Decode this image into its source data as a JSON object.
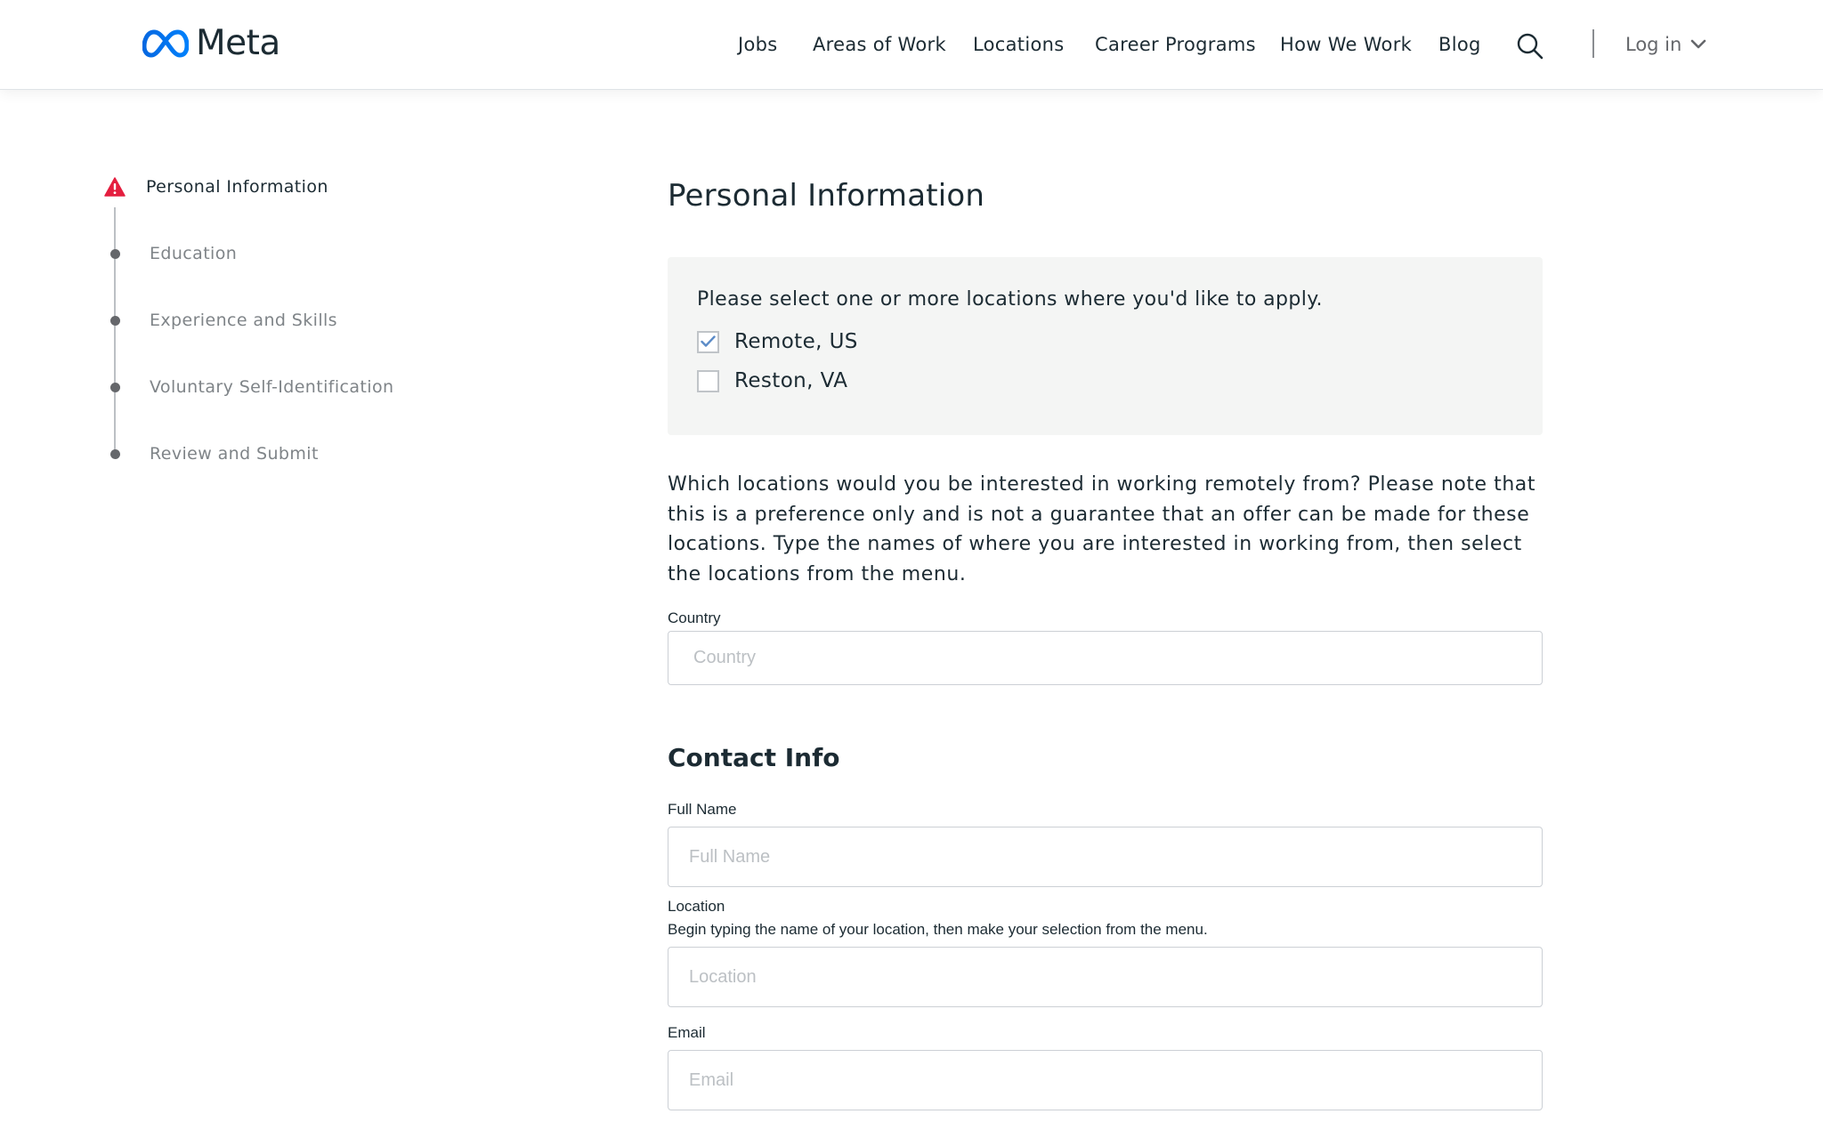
{
  "header": {
    "brand": "Meta",
    "nav": [
      "Jobs",
      "Areas of Work",
      "Locations",
      "Career Programs",
      "How We Work",
      "Blog"
    ],
    "login_label": "Log in"
  },
  "stepper": {
    "steps": [
      {
        "label": "Personal Information",
        "state": "error"
      },
      {
        "label": "Education",
        "state": "pending"
      },
      {
        "label": "Experience and Skills",
        "state": "pending"
      },
      {
        "label": "Voluntary Self-Identification",
        "state": "pending"
      },
      {
        "label": "Review and Submit",
        "state": "pending"
      }
    ]
  },
  "main": {
    "title": "Personal Information",
    "locations": {
      "prompt": "Please select one or more locations where you'd like to apply.",
      "options": [
        {
          "label": "Remote, US",
          "checked": true
        },
        {
          "label": "Reston, VA",
          "checked": false
        }
      ]
    },
    "remote_question": "Which locations would you be interested in working remotely from? Please note that this is a preference only and is not a guarantee that an offer can be made for these locations. Type the names of where you are interested in working from, then select the locations from the menu.",
    "country": {
      "label": "Country",
      "placeholder": "Country",
      "value": ""
    },
    "contact": {
      "title": "Contact Info",
      "full_name": {
        "label": "Full Name",
        "placeholder": "Full Name",
        "value": ""
      },
      "location": {
        "label": "Location",
        "help": "Begin typing the name of your location, then make your selection from the menu.",
        "placeholder": "Location",
        "value": ""
      },
      "email": {
        "label": "Email",
        "placeholder": "Email",
        "value": ""
      }
    }
  },
  "colors": {
    "brand_blue": "#0668e1",
    "error_red": "#e41e3f",
    "check_blue": "#5b8bc7",
    "panel_bg": "#f4f5f4"
  }
}
